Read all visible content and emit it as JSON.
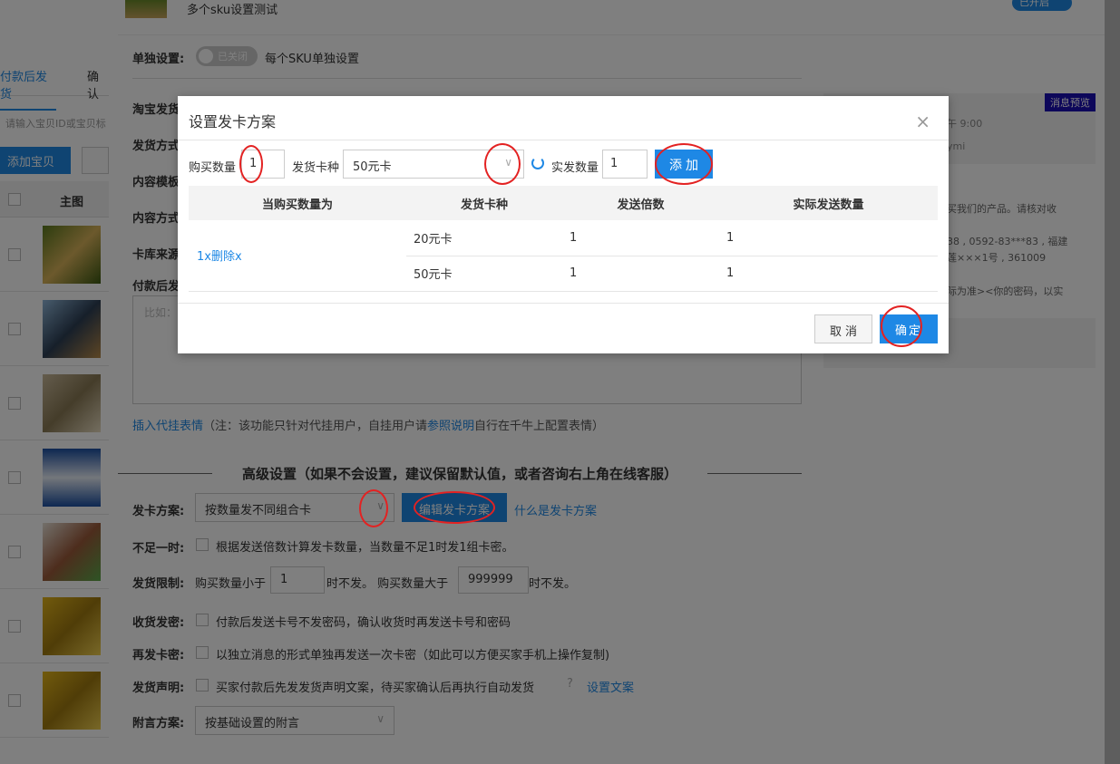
{
  "background": {
    "tabs": [
      "付款后发货",
      "确认"
    ],
    "search_placeholder": "请输入宝贝ID或宝贝标",
    "add_button": "添加宝贝",
    "table_header": "主图",
    "item_title": "多个sku设置测试",
    "toggle_on_label": "已开启",
    "single_setting_label": "单独设置:",
    "single_setting_toggle": "已关闭",
    "single_setting_desc": "每个SKU单独设置",
    "left_labels": [
      "淘宝发货",
      "发货方式",
      "内容模板",
      "内容方式",
      "卡库来源",
      "付款后发"
    ],
    "textarea_placeholder": "比如：",
    "insert_link": "插入代挂表情",
    "insert_note_1": "（注：该功能只针对代挂用户，自挂用户请",
    "insert_note_link": "参照说明",
    "insert_note_2": "自行在千牛上配置表情）",
    "advanced_title": "高级设置（如果不会设置，建议保留默认值，或者咨询右上角在线客服）",
    "card_plan_label": "发卡方案:",
    "card_plan_value": "按数量发不同组合卡",
    "edit_plan_button": "编辑发卡方案",
    "what_is_plan_link": "什么是发卡方案",
    "shortage_label": "不足一时:",
    "shortage_text": "根据发送倍数计算发卡数量，当数量不足1时发1组卡密。",
    "limit_label": "发货限制:",
    "limit_text_1": "购买数量小于",
    "limit_min": "1",
    "limit_text_2": "时不发。 购买数量大于",
    "limit_max": "999999",
    "limit_text_3": "时不发。",
    "receive_label": "收货发密:",
    "receive_text": "付款后发送卡号不发密码，确认收货时再发送卡号和密码",
    "resend_label": "再发卡密:",
    "resend_text": "以独立消息的形式单独再发送一次卡密（如此可以方便买家手机上操作复制)",
    "statement_label": "发货声明:",
    "statement_text": "买家付款后先发发货声明文案，待买家确认后再执行自动发货",
    "statement_link": "设置文案",
    "remark_label": "附言方案:",
    "remark_value": "按基础设置的附言",
    "preview_badge": "消息预览",
    "preview_lines": [
      "午 9:00",
      "ymi",
      "买我们的产品。请核对收",
      "38 , 0592-83***83 , 福建",
      "莲×××1号 , 361009",
      "际为准><你的密码，以实"
    ]
  },
  "modal": {
    "title": "设置发卡方案",
    "close_icon": "×",
    "qty_label": "购买数量",
    "qty_value": "1",
    "card_type_label": "发货卡种",
    "card_type_value": "50元卡",
    "actual_qty_label": "实发数量",
    "actual_qty_value": "1",
    "add_button": "添加",
    "table": {
      "headers": [
        "当购买数量为",
        "发货卡种",
        "发送倍数",
        "实际发送数量"
      ],
      "group_qty": "1x",
      "delete_link": "删除x",
      "rows": [
        {
          "card": "20元卡",
          "multiple": "1",
          "actual": "1"
        },
        {
          "card": "50元卡",
          "multiple": "1",
          "actual": "1"
        }
      ]
    },
    "cancel_button": "取消",
    "ok_button": "确定"
  }
}
